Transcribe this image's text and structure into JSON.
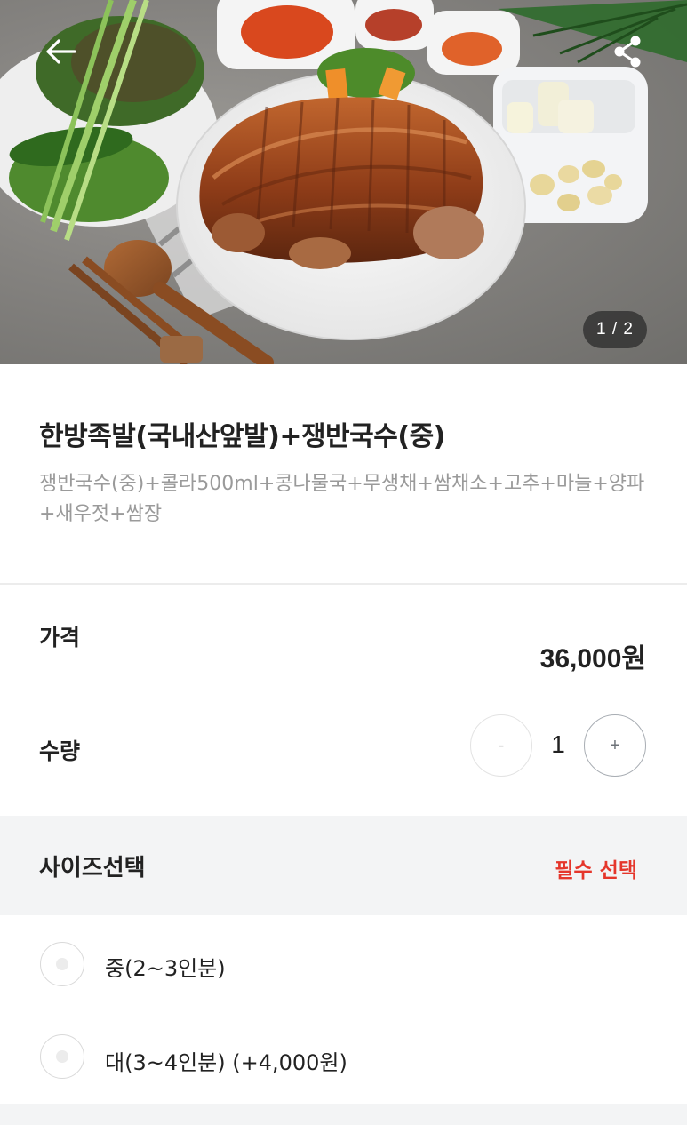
{
  "hero": {
    "pager_text": "1 / 2",
    "back_icon": "arrow-left-icon",
    "share_icon": "share-icon"
  },
  "menu": {
    "title": "한방족발(국내산앞발)+쟁반국수(중)",
    "description": "쟁반국수(중)+콜라500ml+콩나물국+무생채+쌈채소+고추+마늘+양파+새우젓+쌈장"
  },
  "price": {
    "label": "가격",
    "value": "36,000원"
  },
  "quantity": {
    "label": "수량",
    "minus": "-",
    "value": "1",
    "plus": "+"
  },
  "size_section": {
    "title": "사이즈선택",
    "required": "필수 선택",
    "options": [
      {
        "label": "중(2~3인분)"
      },
      {
        "label": "대(3~4인분) (+4,000원)"
      }
    ]
  },
  "colors": {
    "required_red": "#e5362b",
    "section_bg": "#f3f4f5",
    "desc_gray": "#9a9a9a"
  }
}
